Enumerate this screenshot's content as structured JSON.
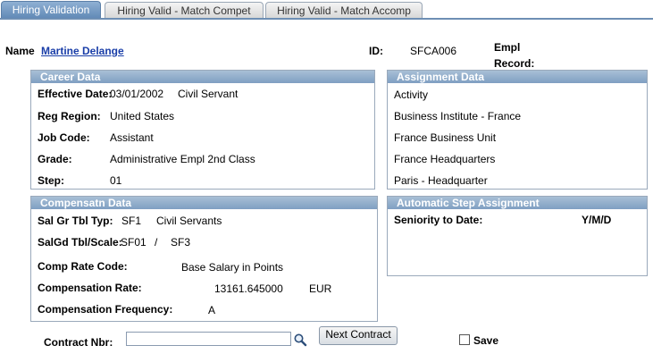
{
  "tabs": [
    {
      "label": "Hiring Validation"
    },
    {
      "label": "Hiring Valid - Match Compet"
    },
    {
      "label": "Hiring Valid - Match Accomp"
    }
  ],
  "header": {
    "name_label": "Name",
    "name_value": "Martine Delange",
    "id_label": "ID:",
    "id_value": "SFCA006",
    "empl_record_label_1": "Empl",
    "empl_record_label_2": "Record:"
  },
  "career": {
    "title": "Career Data",
    "effective_date_label": "Effective Date:",
    "effective_date_value": "03/01/2002",
    "effective_date_extra": "Civil Servant",
    "reg_region_label": "Reg Region:",
    "reg_region_value": "United States",
    "job_code_label": "Job Code:",
    "job_code_value": "Assistant",
    "grade_label": "Grade:",
    "grade_value": "Administrative Empl 2nd Class",
    "step_label": "Step:",
    "step_value": "01"
  },
  "assignment": {
    "title": "Assignment Data",
    "items": [
      "Activity",
      "Business Institute - France",
      "France Business Unit",
      "France Headquarters",
      "Paris - Headquarter"
    ]
  },
  "comp": {
    "title": "Compensatn Data",
    "sal_gr_label": "Sal Gr Tbl Typ:",
    "sal_gr_code": "SF1",
    "sal_gr_desc": "Civil Servants",
    "salgd_label": "SalGd Tbl/Scale:",
    "salgd_code": "SF01",
    "salgd_sep": "/",
    "salgd_scale": "SF3",
    "rate_code_label": "Comp Rate Code:",
    "rate_code_value": "Base Salary in Points",
    "rate_label": "Compensation Rate:",
    "rate_value": "13161.645000",
    "rate_currency": "EUR",
    "freq_label": "Compensation Frequency:",
    "freq_value": "A"
  },
  "auto_step": {
    "title": "Automatic Step Assignment",
    "seniority_label": "Seniority to Date:",
    "seniority_value": "Y/M/D"
  },
  "footer": {
    "contract_label": "Contract Nbr:",
    "contract_value": "",
    "next_contract_label": "Next Contract",
    "save_label": "Save"
  },
  "icons": {
    "lookup": "magnifier-icon"
  }
}
